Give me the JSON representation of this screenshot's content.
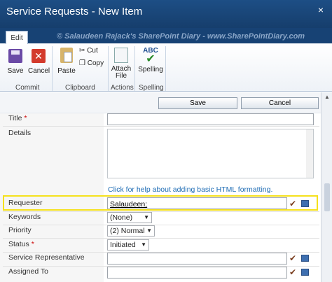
{
  "window": {
    "title": "Service Requests - New Item",
    "close_glyph": "×"
  },
  "ribbon": {
    "tab_label": "Edit",
    "watermark": "© Salaudeen Rajack's SharePoint Diary - www.SharePointDiary.com",
    "buttons": {
      "save": "Save",
      "cancel": "Cancel",
      "paste": "Paste",
      "cut": "Cut",
      "copy": "Copy",
      "attach_line1": "Attach",
      "attach_line2": "File",
      "spelling": "Spelling",
      "abc": "ABC"
    },
    "groups": {
      "commit": "Commit",
      "clipboard": "Clipboard",
      "actions": "Actions",
      "spelling": "Spelling"
    }
  },
  "form": {
    "save_label": "Save",
    "cancel_label": "Cancel",
    "fields": {
      "title": {
        "label": "Title",
        "required_mark": "*",
        "value": ""
      },
      "details": {
        "label": "Details",
        "help_link": "Click for help about adding basic HTML formatting."
      },
      "requester": {
        "label": "Requester",
        "value": "Salaudeen;"
      },
      "keywords": {
        "label": "Keywords",
        "value": "(None)"
      },
      "priority": {
        "label": "Priority",
        "value": "(2) Normal"
      },
      "status": {
        "label": "Status",
        "required_mark": "*",
        "value": "Initiated"
      },
      "service_rep": {
        "label": "Service Representative",
        "value": ""
      },
      "assigned_to": {
        "label": "Assigned To",
        "value": ""
      }
    }
  },
  "icons": {
    "save": "save-icon",
    "cancel": "cancel-icon",
    "paste": "paste-icon",
    "cut": "scissors-icon",
    "copy": "copy-icon",
    "attach": "attach-file-icon",
    "spelling": "spelling-check-icon",
    "check_names": "check-names-icon",
    "address_book": "address-book-icon"
  },
  "colors": {
    "titlebar": "#1d4e85",
    "highlight": "#f5e11d",
    "link": "#1f6db5",
    "required": "#cc0000"
  }
}
